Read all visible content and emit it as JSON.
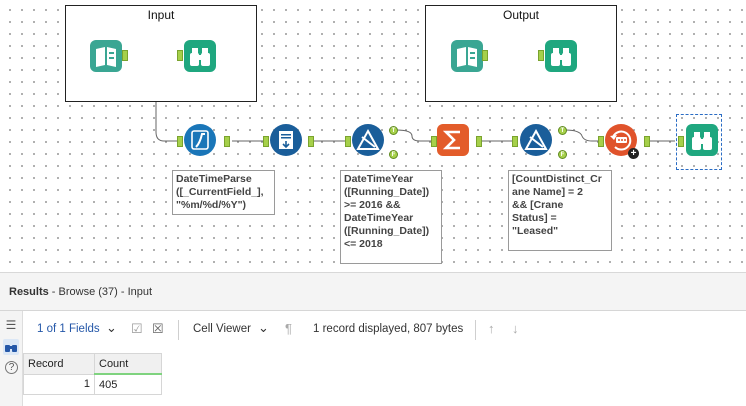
{
  "canvas": {
    "containers": [
      {
        "title": "Input"
      },
      {
        "title": "Output"
      }
    ],
    "annotations": {
      "datetime_parse": "DateTimeParse\n([_CurrentField_],\n\"%m/%d/%Y\")",
      "filter_year": "DateTimeYear\n([Running_Date])\n>= 2016 &&\nDateTimeYear\n([Running_Date])\n<= 2018",
      "filter_crane": "[CountDistinct_Cr\nane Name] = 2\n&& [Crane\nStatus] =\n\"Leased\""
    },
    "anchor_labels": {
      "true": "T",
      "false": "F"
    },
    "colors": {
      "input_tool": "#3aa693",
      "browse_tool": "#1fa77f",
      "formula_tool": "#1a76b8",
      "select_tool": "#1a5e9a",
      "filter_tool": "#1a5e9a",
      "summarize_tool": "#e35c2a",
      "sample_tool": "#e0532b",
      "anchor": "#a6d04a"
    }
  },
  "results": {
    "title_bold": "Results",
    "title_rest": " - Browse (37) - Input",
    "toolbar": {
      "fields_label": "1 of 1 Fields",
      "viewer_label": "Cell Viewer",
      "status": "1 record displayed, 807 bytes"
    },
    "table": {
      "headers": [
        "Record",
        "Count"
      ],
      "rows": [
        [
          "1",
          "405"
        ]
      ]
    }
  }
}
